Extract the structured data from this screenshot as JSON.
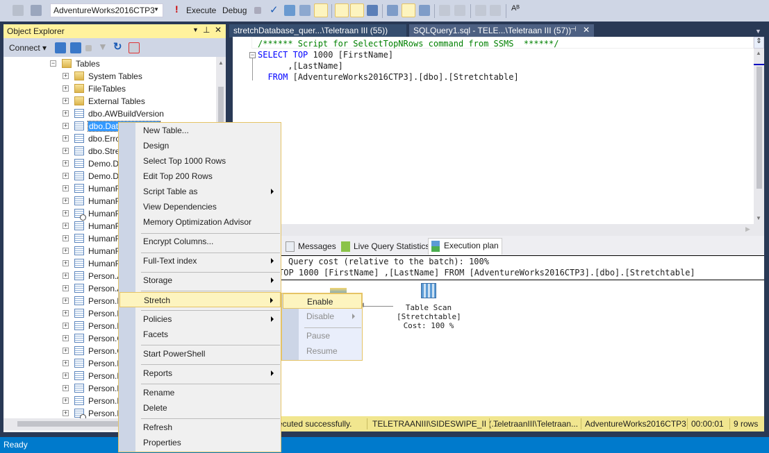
{
  "toolbar": {
    "database": "AdventureWorks2016CTP3",
    "execute_label": "Execute",
    "debug_label": "Debug",
    "icons": [
      "new-query-icon",
      "change-connection-icon",
      "execute-icon",
      "stop-icon",
      "parse-icon",
      "estimated-plan-icon",
      "results-to-icon",
      "include-actual-plan-icon",
      "live-stats-icon",
      "client-stats-icon",
      "comment-icon",
      "indent-icon",
      "spell-icon"
    ]
  },
  "object_explorer": {
    "title": "Object Explorer",
    "connect_label": "Connect",
    "tree": [
      {
        "label": "Tables",
        "icon": "folder",
        "expanded": true,
        "level": 0
      },
      {
        "label": "System Tables",
        "icon": "folder"
      },
      {
        "label": "FileTables",
        "icon": "folder"
      },
      {
        "label": "External Tables",
        "icon": "folder"
      },
      {
        "label": "dbo.AWBuildVersion",
        "icon": "table"
      },
      {
        "label": "dbo.Dat",
        "icon": "table",
        "selected": true
      },
      {
        "label": "dbo.Errc",
        "icon": "table"
      },
      {
        "label": "dbo.Stre",
        "icon": "table"
      },
      {
        "label": "Demo.D",
        "icon": "table"
      },
      {
        "label": "Demo.D",
        "icon": "table"
      },
      {
        "label": "HumanR",
        "icon": "table"
      },
      {
        "label": "HumanR",
        "icon": "table"
      },
      {
        "label": "HumanR",
        "icon": "temporal-table"
      },
      {
        "label": "HumanR",
        "icon": "table"
      },
      {
        "label": "HumanR",
        "icon": "table"
      },
      {
        "label": "HumanR",
        "icon": "table"
      },
      {
        "label": "HumanR",
        "icon": "table"
      },
      {
        "label": "Person.A",
        "icon": "table"
      },
      {
        "label": "Person.A",
        "icon": "table"
      },
      {
        "label": "Person.B",
        "icon": "table"
      },
      {
        "label": "Person.B",
        "icon": "table"
      },
      {
        "label": "Person.B",
        "icon": "table"
      },
      {
        "label": "Person.C",
        "icon": "table"
      },
      {
        "label": "Person.C",
        "icon": "table"
      },
      {
        "label": "Person.E",
        "icon": "table"
      },
      {
        "label": "Person.P",
        "icon": "table"
      },
      {
        "label": "Person.P",
        "icon": "table"
      },
      {
        "label": "Person.P",
        "icon": "table"
      },
      {
        "label": "Person.P",
        "icon": "temporal-table"
      }
    ]
  },
  "tabs": [
    {
      "label": "stretchDatabase_quer...\\Teletraan III (55))"
    },
    {
      "label": "SQLQuery1.sql - TELE...\\Teletraan III (57))",
      "active": true
    }
  ],
  "editor": {
    "comment": "/****** Script for SelectTopNRows command from SSMS  ******/",
    "line1_kw1": "SELECT",
    "line1_kw2": "TOP",
    "line1_rest": "1000 [FirstName]",
    "line2": "      ,[LastName]",
    "line3_kw": "FROM",
    "line3_rest": "[AdventureWorks2016CTP3].[dbo].[Stretchtable]"
  },
  "results": {
    "tabs": [
      "Messages",
      "Live Query Statistics",
      "Execution plan"
    ],
    "active_tab": "Execution plan",
    "query_cost": "Query cost (relative to the batch): 100%",
    "query_text": "TOP 1000 [FirstName] ,[LastName] FROM [AdventureWorks2016CTP3].[dbo].[Stretchtable]",
    "operator": {
      "name": "Table Scan",
      "object": "[Stretchtable]",
      "cost": "Cost: 100 %"
    }
  },
  "query_status": {
    "message": "ecuted successfully.",
    "server": "TELETRAANIII\\SIDESWIPE_II (...",
    "user": "TeletraanIII\\Teletraan...",
    "database": "AdventureWorks2016CTP3",
    "elapsed": "00:00:01",
    "rows": "9 rows"
  },
  "app_status": "Ready",
  "context_menu": {
    "items": [
      {
        "label": "New Table..."
      },
      {
        "label": "Design"
      },
      {
        "label": "Select Top 1000 Rows"
      },
      {
        "label": "Edit Top 200 Rows"
      },
      {
        "label": "Script Table as",
        "submenu": true
      },
      {
        "label": "View Dependencies"
      },
      {
        "label": "Memory Optimization Advisor"
      },
      {
        "label": "Encrypt Columns..."
      },
      {
        "label": "Full-Text index",
        "submenu": true
      },
      {
        "label": "Storage",
        "submenu": true
      },
      {
        "label": "Stretch",
        "submenu": true,
        "highlighted": true
      },
      {
        "label": "Policies",
        "submenu": true
      },
      {
        "label": "Facets"
      },
      {
        "label": "Start PowerShell"
      },
      {
        "label": "Reports",
        "submenu": true
      },
      {
        "label": "Rename"
      },
      {
        "label": "Delete"
      },
      {
        "label": "Refresh"
      },
      {
        "label": "Properties"
      }
    ]
  },
  "stretch_submenu": {
    "items": [
      {
        "label": "Enable",
        "highlighted": true
      },
      {
        "label": "Disable",
        "disabled": true,
        "submenu": true
      },
      {
        "label": "Pause",
        "disabled": true
      },
      {
        "label": "Resume",
        "disabled": true
      }
    ]
  }
}
